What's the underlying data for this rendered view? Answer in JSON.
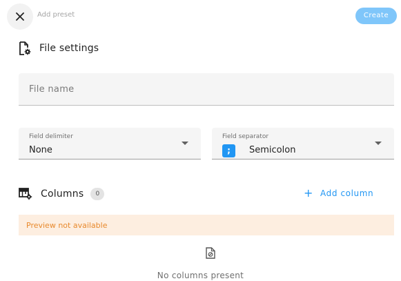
{
  "header": {
    "title": "Add preset",
    "create_label": "Create",
    "close_icon": "close-icon"
  },
  "file_settings": {
    "heading": "File settings",
    "icon": "file-settings-icon",
    "file_name_placeholder": "File name",
    "field_delimiter": {
      "label": "Field delimiter",
      "value": "None"
    },
    "field_separator": {
      "label": "Field separator",
      "chip": ";",
      "value": "Semicolon"
    }
  },
  "columns": {
    "heading": "Columns",
    "icon": "table-settings-icon",
    "count": "0",
    "add_label": "Add column",
    "add_icon": "+",
    "preview_notice": "Preview not available",
    "empty_icon": "file-empty-icon",
    "empty_text": "No columns present"
  },
  "colors": {
    "accent": "#2196f3",
    "create_button": "#7fc6fa",
    "warning_bg": "#fdeee0",
    "warning_text": "#e8892c"
  }
}
